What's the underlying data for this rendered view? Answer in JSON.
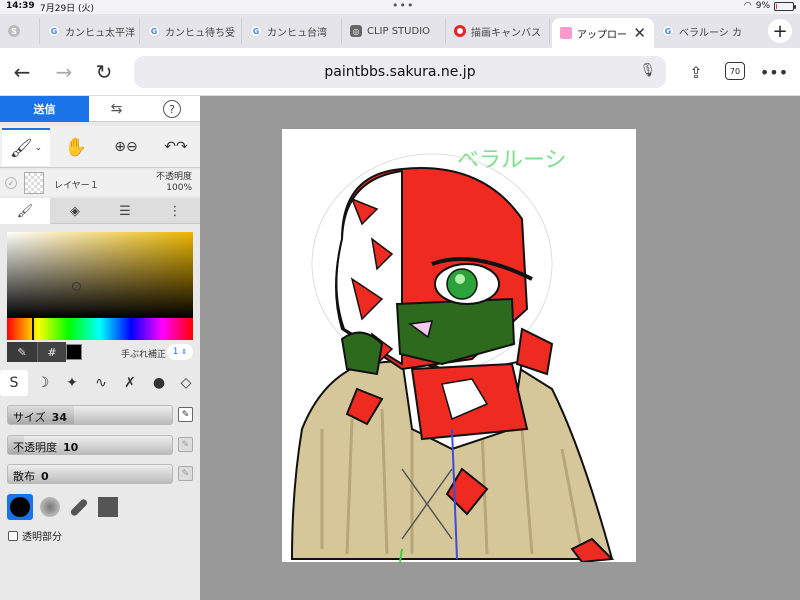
{
  "status": {
    "time": "14:39",
    "date": "7月29日 (火)",
    "battery": "9%",
    "battery_level": 0.09
  },
  "tabs": [
    {
      "title": "",
      "icon": "fav-gray"
    },
    {
      "title": "カンヒュ太平洋",
      "icon": "G"
    },
    {
      "title": "カンヒュ待ち受",
      "icon": "G"
    },
    {
      "title": "カンヒュ台湾",
      "icon": "G"
    },
    {
      "title": "CLIP STUDIO",
      "icon": "clip"
    },
    {
      "title": "描画キャンバス",
      "icon": "red"
    },
    {
      "title": "アップロー",
      "icon": "app",
      "active": true
    },
    {
      "title": "ベラルーシ カ",
      "icon": "G"
    }
  ],
  "browser": {
    "url": "paintbbs.sakura.ne.jp",
    "tab_count": "70",
    "add_tab": "+"
  },
  "panel": {
    "send_label": "送信",
    "swap_icon": "⇆",
    "help_icon": "?",
    "layer_name": "レイヤー１",
    "opacity_label": "不透明度",
    "opacity_value": "100%",
    "hash": "#",
    "stabilizer_label": "手ぶれ補正",
    "stabilizer_value": "1",
    "sliders": [
      {
        "label": "サイズ",
        "value": "34",
        "level": 0.4
      },
      {
        "label": "不透明度",
        "value": "10",
        "level": 0.1
      },
      {
        "label": "散布",
        "value": "0",
        "level": 0.0
      }
    ],
    "transparent_label": "透明部分"
  },
  "canvas": {
    "title_text": "ベラルーシ"
  },
  "colors": {
    "accent": "#1a73e8",
    "canvas_bg": "#ffffff",
    "workspace": "#999999"
  }
}
